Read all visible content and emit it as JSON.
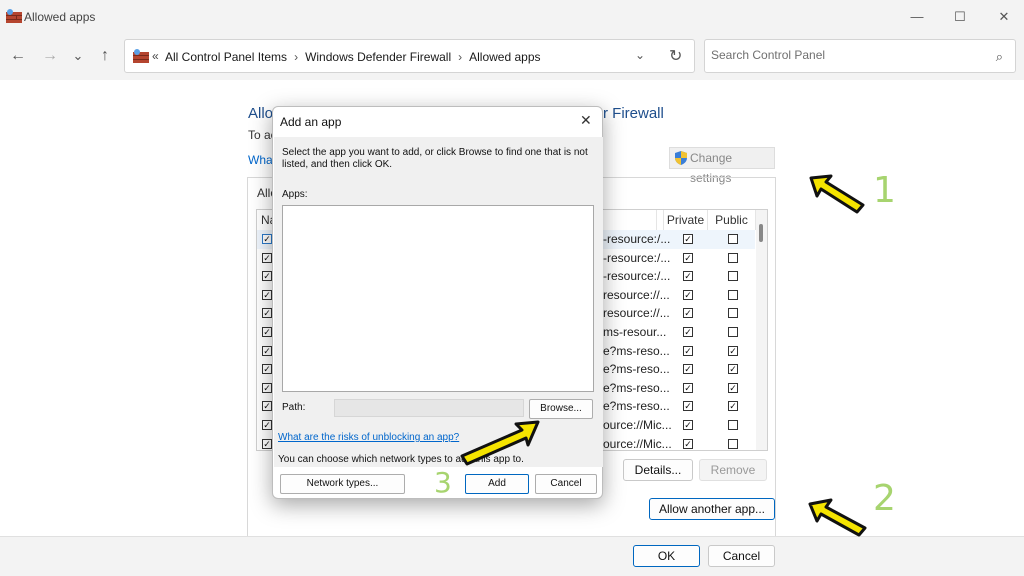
{
  "window": {
    "title": "Allowed apps",
    "minimize_glyph": "—",
    "maximize_glyph": "☐",
    "close_glyph": "✕"
  },
  "nav": {
    "back_glyph": "←",
    "forward_glyph": "→",
    "recent_glyph": "⌄",
    "up_glyph": "↑"
  },
  "address": {
    "breadcrumb_prefix": "«",
    "crumbs": [
      "All Control Panel Items",
      "Windows Defender Firewall",
      "Allowed apps"
    ],
    "crumb_separator": "›",
    "dropdown_glyph": "⌄",
    "refresh_glyph": "↻"
  },
  "search": {
    "placeholder": "Search Control Panel",
    "icon_glyph": "⌕"
  },
  "main": {
    "heading_visible": "Allo",
    "heading_tail": "r Firewall",
    "subtitle_visible": "To ac",
    "link_visible": "What",
    "change_settings_label": "Change settings",
    "group_title_visible": "Allo",
    "columns": {
      "name_visible": "Na",
      "private": "Private",
      "public": "Public"
    },
    "rows": [
      {
        "first": true,
        "name_tail": "-resource:/...",
        "private": true,
        "public": false
      },
      {
        "first": true,
        "name_tail": "-resource:/...",
        "private": true,
        "public": false
      },
      {
        "first": true,
        "name_tail": "-resource:/...",
        "private": true,
        "public": false
      },
      {
        "first": true,
        "name_tail": "resource://...",
        "private": true,
        "public": false
      },
      {
        "first": true,
        "name_tail": "resource://...",
        "private": true,
        "public": false
      },
      {
        "first": true,
        "name_tail": "ms-resour...",
        "private": true,
        "public": false
      },
      {
        "first": true,
        "name_tail": "e?ms-reso...",
        "private": true,
        "public": true
      },
      {
        "first": true,
        "name_tail": "e?ms-reso...",
        "private": true,
        "public": true
      },
      {
        "first": true,
        "name_tail": "e?ms-reso...",
        "private": true,
        "public": true
      },
      {
        "first": true,
        "name_tail": "e?ms-reso...",
        "private": true,
        "public": true
      },
      {
        "first": true,
        "name_tail": "ource://Mic...",
        "private": true,
        "public": false
      },
      {
        "first": true,
        "name_tail": "ource://Mic...",
        "private": true,
        "public": false
      }
    ],
    "details_label": "Details...",
    "remove_label": "Remove",
    "allow_another_label": "Allow another app..."
  },
  "footer": {
    "ok_label": "OK",
    "cancel_label": "Cancel"
  },
  "dialog": {
    "title": "Add an app",
    "close_glyph": "✕",
    "instructions": "Select the app you want to add, or click Browse to find one that is not listed, and then click OK.",
    "apps_label": "Apps:",
    "path_label": "Path:",
    "path_value": "",
    "browse_label": "Browse...",
    "risk_link": "What are the risks of unblocking an app?",
    "network_text": "You can choose which network types to add this app to.",
    "network_types_label": "Network types...",
    "add_label": "Add",
    "cancel_label": "Cancel"
  },
  "annotations": {
    "arrow_color": "#f5e400",
    "number_color": "#a7d46f",
    "labels": [
      "1",
      "2",
      "3"
    ]
  },
  "checkbox_glyph": "✓"
}
